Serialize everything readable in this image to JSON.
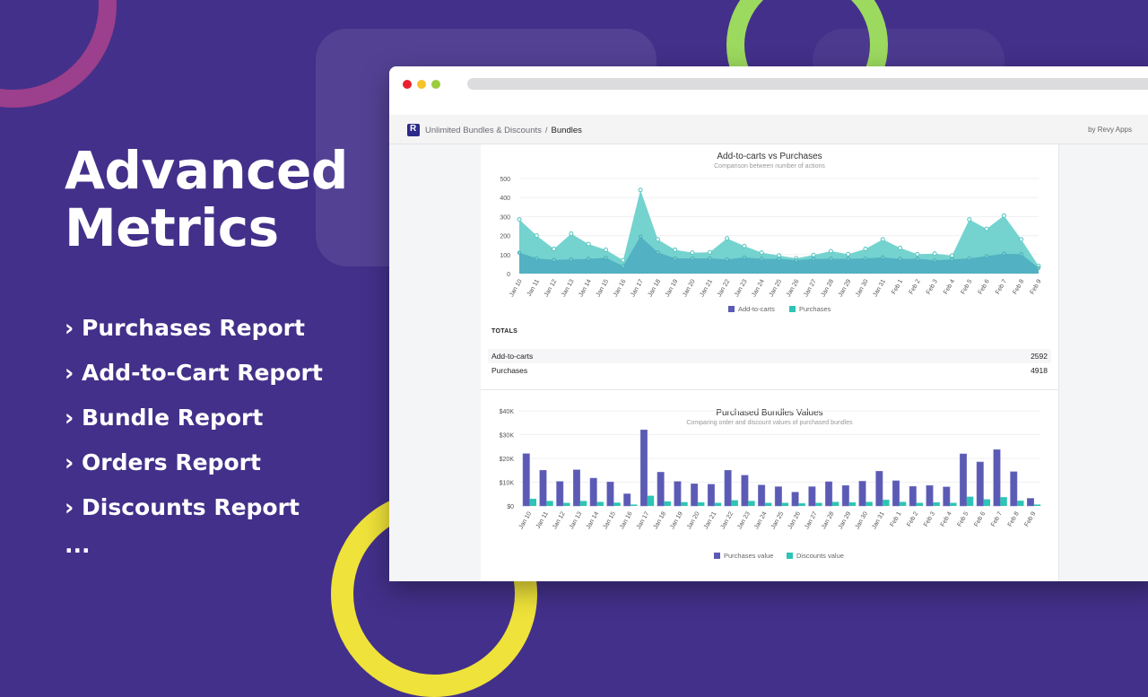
{
  "hero": {
    "title_line1": "Advanced",
    "title_line2": "Metrics",
    "features": [
      "› Purchases Report",
      "› Add-to-Cart Report",
      "› Bundle Report",
      "› Orders Report",
      "› Discounts Report"
    ],
    "more": "..."
  },
  "colors": {
    "background": "#43308a",
    "ring_pink": "#9c3f8c",
    "ring_green": "#9cd95f",
    "ring_yellow": "#efe23a",
    "addtocart": "#5b5ab4",
    "purchases": "#2ec4b6",
    "area_purchases": "#74d3cf",
    "area_addtocart": "#52b1c2"
  },
  "window": {
    "breadcrumb": {
      "app": "Unlimited Bundles & Discounts",
      "separator": "/",
      "current": "Bundles"
    },
    "byline": "by Revy Apps",
    "logo_icon": "revy-logo-icon"
  },
  "totals": {
    "heading": "TOTALS",
    "rows": [
      {
        "label": "Add-to-carts",
        "value": "2592"
      },
      {
        "label": "Purchases",
        "value": "4918"
      }
    ]
  },
  "chart_data": [
    {
      "type": "area",
      "title": "Add-to-carts vs Purchases",
      "subtitle": "Comparison between number of actions",
      "xlabel": "",
      "ylabel": "",
      "ylim": [
        0,
        500
      ],
      "yticks": [
        "0",
        "100",
        "200",
        "300",
        "400",
        "500"
      ],
      "grid": true,
      "legend_position": "bottom",
      "categories": [
        "Jan 10",
        "Jan 11",
        "Jan 12",
        "Jan 13",
        "Jan 14",
        "Jan 15",
        "Jan 16",
        "Jan 17",
        "Jan 18",
        "Jan 19",
        "Jan 20",
        "Jan 21",
        "Jan 22",
        "Jan 23",
        "Jan 24",
        "Jan 25",
        "Jan 26",
        "Jan 27",
        "Jan 28",
        "Jan 29",
        "Jan 30",
        "Jan 31",
        "Feb 1",
        "Feb 2",
        "Feb 3",
        "Feb 4",
        "Feb 5",
        "Feb 6",
        "Feb 7",
        "Feb 8",
        "Feb 9"
      ],
      "series": [
        {
          "name": "Add-to-carts",
          "values": [
            110,
            80,
            72,
            75,
            78,
            83,
            40,
            195,
            112,
            80,
            80,
            80,
            75,
            85,
            78,
            78,
            70,
            78,
            78,
            78,
            80,
            85,
            78,
            78,
            70,
            75,
            80,
            92,
            105,
            102,
            30
          ]
        },
        {
          "name": "Purchases",
          "values": [
            285,
            200,
            130,
            210,
            155,
            125,
            70,
            440,
            180,
            125,
            110,
            112,
            185,
            145,
            110,
            95,
            80,
            98,
            118,
            102,
            130,
            180,
            135,
            102,
            105,
            95,
            285,
            235,
            305,
            180,
            40
          ]
        }
      ]
    },
    {
      "type": "bar",
      "title": "Purchased Bundles Values",
      "subtitle": "Comparing order and discount values of purchased bundles",
      "xlabel": "",
      "ylabel": "",
      "ylim": [
        0,
        40000
      ],
      "yticks": [
        "$0",
        "$10K",
        "$20K",
        "$30K",
        "$40K"
      ],
      "grid": true,
      "legend_position": "bottom",
      "categories": [
        "Jan 10",
        "Jan 11",
        "Jan 12",
        "Jan 13",
        "Jan 14",
        "Jan 15",
        "Jan 16",
        "Jan 17",
        "Jan 18",
        "Jan 19",
        "Jan 20",
        "Jan 21",
        "Jan 22",
        "Jan 23",
        "Jan 24",
        "Jan 25",
        "Jan 26",
        "Jan 27",
        "Jan 28",
        "Jan 29",
        "Jan 30",
        "Jan 31",
        "Feb 1",
        "Feb 2",
        "Feb 3",
        "Feb 4",
        "Feb 5",
        "Feb 6",
        "Feb 7",
        "Feb 8",
        "Feb 9"
      ],
      "series": [
        {
          "name": "Purchases value",
          "values": [
            22000,
            15000,
            10300,
            15200,
            11700,
            10100,
            5100,
            32000,
            14200,
            10300,
            9300,
            9100,
            15000,
            12900,
            8800,
            8100,
            5800,
            8100,
            10200,
            8600,
            10400,
            14600,
            10600,
            8200,
            8600,
            8000,
            21900,
            18500,
            23700,
            14400,
            3200
          ]
        },
        {
          "name": "Discounts value",
          "values": [
            3000,
            2100,
            1300,
            2100,
            1700,
            1400,
            600,
            4300,
            1900,
            1600,
            1500,
            1300,
            2400,
            2100,
            1300,
            1300,
            1100,
            1300,
            1700,
            1500,
            1700,
            2600,
            1700,
            1300,
            1500,
            1300,
            3900,
            2800,
            3700,
            2200,
            600
          ]
        }
      ]
    }
  ]
}
